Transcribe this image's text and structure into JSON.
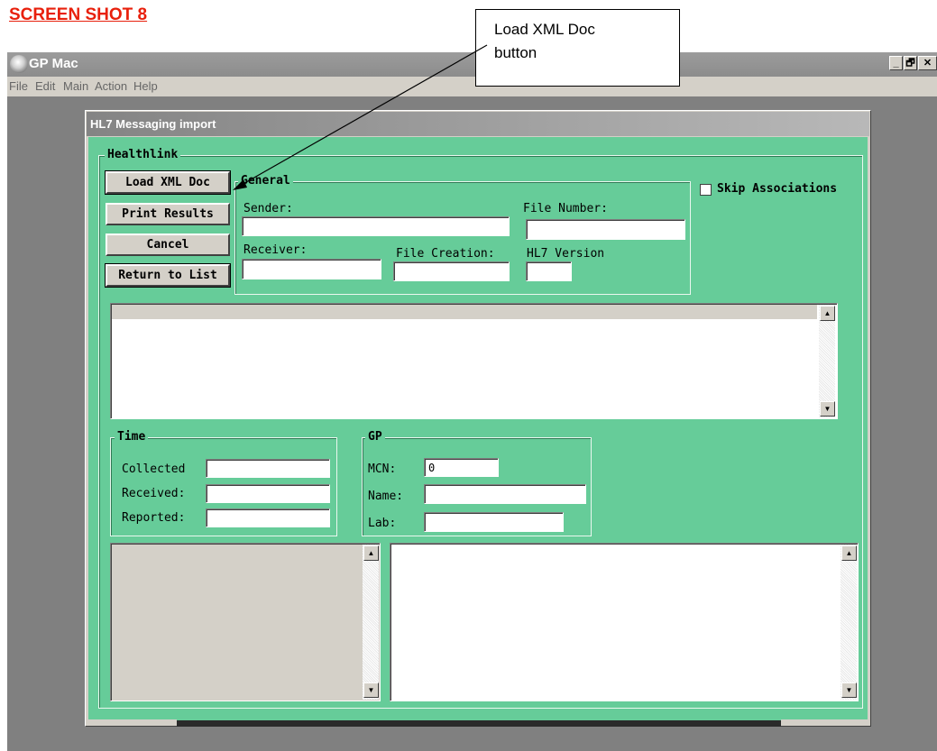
{
  "doc_heading": "SCREEN SHOT 8",
  "callout": {
    "text": "Load XML Doc\nbutton"
  },
  "app": {
    "title": "GP Mac",
    "controls": {
      "minimize": "_",
      "restore": "🗗",
      "close": "✕"
    },
    "menu": [
      "File",
      "Edit",
      "Main",
      "Action",
      "Help"
    ]
  },
  "dialog": {
    "title": "HL7 Messaging import",
    "healthlink_label": "Healthlink",
    "buttons": {
      "load_xml": "Load XML Doc",
      "print_results": "Print Results",
      "cancel": "Cancel",
      "return_to_list": "Return to List"
    },
    "general": {
      "label": "General",
      "sender_label": "Sender:",
      "sender_value": "",
      "file_number_label": "File Number:",
      "file_number_value": "",
      "receiver_label": "Receiver:",
      "receiver_value": "",
      "file_creation_label": "File Creation:",
      "file_creation_value": "",
      "hl7_version_label": "HL7 Version",
      "hl7_version_value": ""
    },
    "skip_associations": {
      "label": "Skip Associations",
      "checked": false
    },
    "time": {
      "label": "Time",
      "collected_label": "Collected",
      "collected_value": "",
      "received_label": "Received:",
      "received_value": "",
      "reported_label": "Reported:",
      "reported_value": ""
    },
    "gp": {
      "label": "GP",
      "mcn_label": "MCN:",
      "mcn_value": "0",
      "name_label": "Name:",
      "name_value": "",
      "lab_label": "Lab:",
      "lab_value": ""
    }
  },
  "colors": {
    "dialog_bg": "#66cc99",
    "heading": "#e8200c",
    "chrome": "#d4d0c8"
  },
  "icons": [
    "app-globe-icon",
    "checkbox-icon",
    "scroll-up-arrow-icon",
    "scroll-down-arrow-icon",
    "callout-arrow-icon"
  ]
}
